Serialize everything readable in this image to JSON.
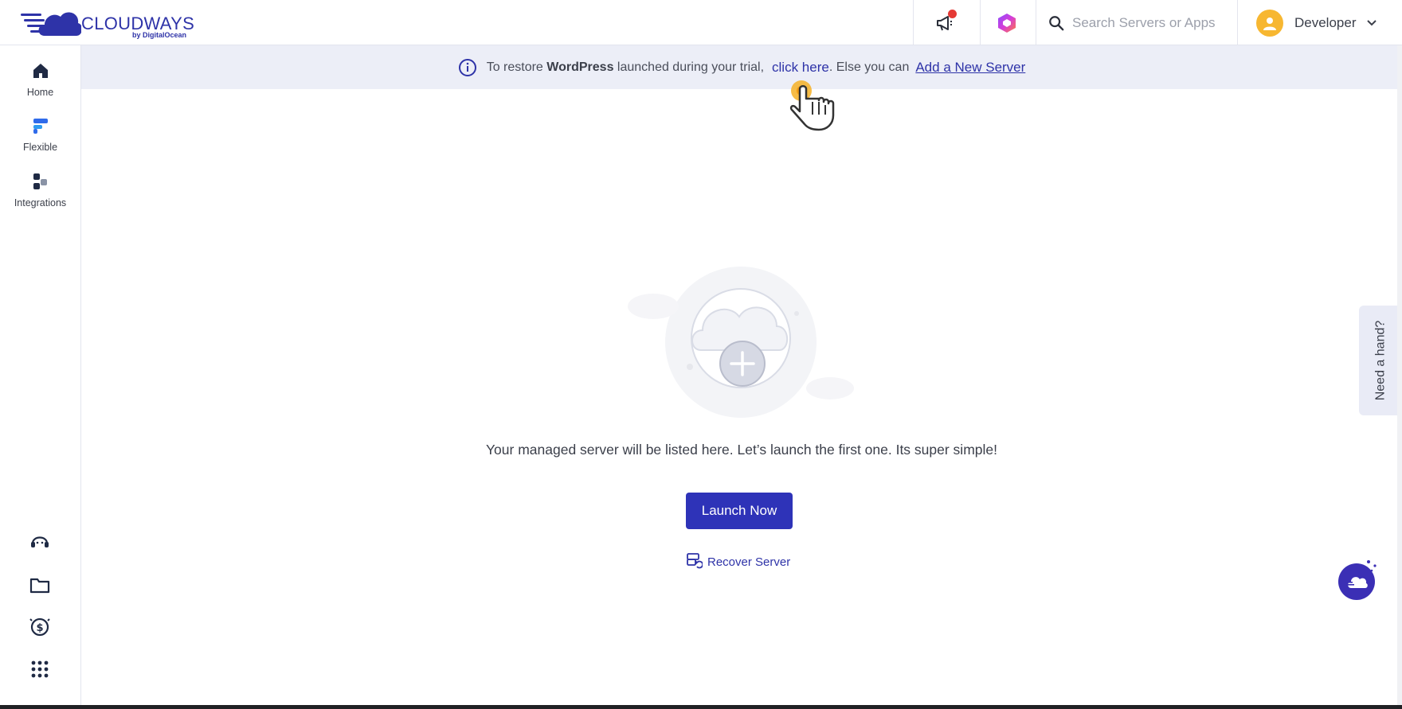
{
  "brand": {
    "name": "CLOUDWAYS",
    "sub": "by DigitalOcean",
    "color": "#2e33a8"
  },
  "header": {
    "announcements_icon": "megaphone-icon",
    "copilot_icon": "copilot-icon",
    "search_placeholder": "Search Servers or Apps",
    "user_name": "Developer"
  },
  "sidebar": {
    "items": [
      {
        "label": "Home",
        "icon": "home-icon"
      },
      {
        "label": "Flexible",
        "icon": "flexible-icon"
      },
      {
        "label": "Integrations",
        "icon": "integrations-icon"
      }
    ],
    "bottom_icons": [
      "support-icon",
      "folder-icon",
      "billing-icon",
      "apps-grid-icon"
    ]
  },
  "banner": {
    "prefix": "To restore ",
    "app": "WordPress",
    "middle": " launched during your trial,",
    "click_here": "click here",
    "else": ". Else you can",
    "add_server": "Add a New Server"
  },
  "empty_state": {
    "message": "Your managed server will be listed here. Let’s launch the first one. Its super simple!",
    "launch_label": "Launch Now",
    "recover_label": "Recover Server"
  },
  "help_tab": {
    "label": "Need a hand?"
  },
  "colors": {
    "accent": "#2e33b8",
    "banner_bg": "#eceef7",
    "avatar": "#f7b731",
    "notification": "#e53935"
  }
}
